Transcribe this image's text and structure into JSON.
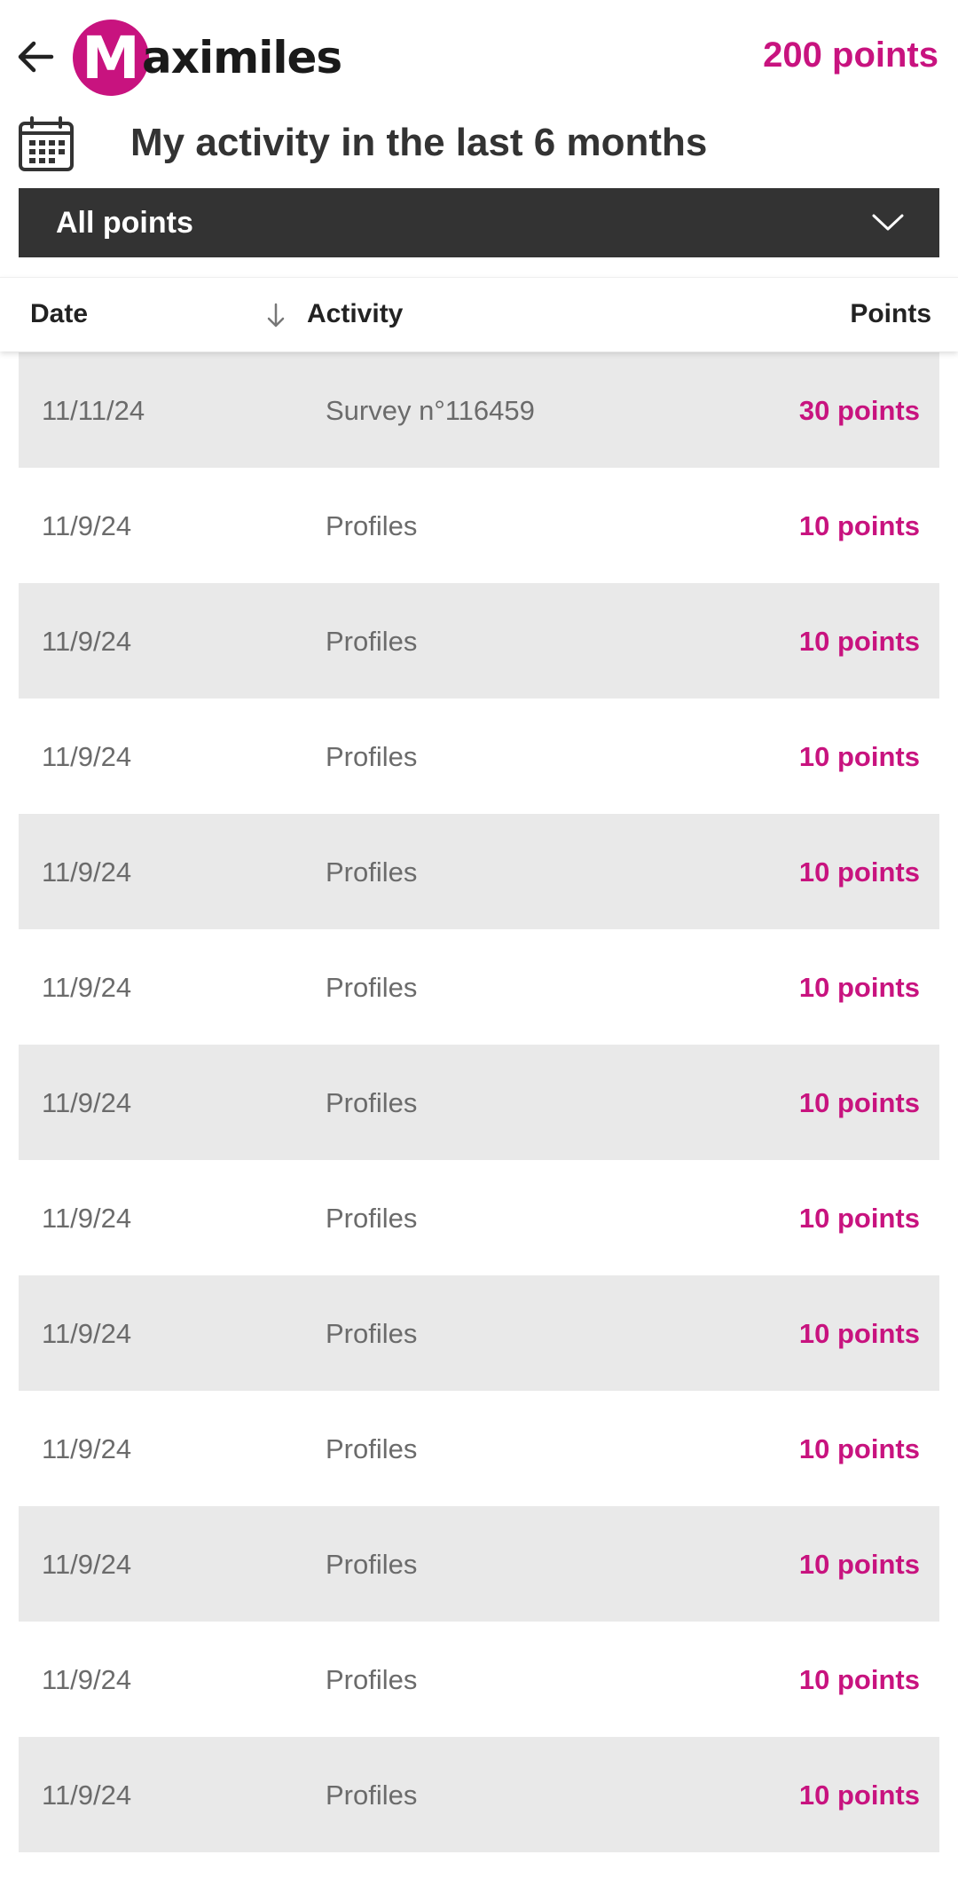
{
  "header": {
    "logo_letter": "M",
    "logo_rest": "aximiles",
    "total_points": "200 points"
  },
  "title": "My activity in the last 6 months",
  "filter": {
    "selected": "All points"
  },
  "table": {
    "columns": [
      "Date",
      "Activity",
      "Points"
    ],
    "rows": [
      {
        "date": "11/11/24",
        "activity": "Survey n°116459",
        "points": "30 points"
      },
      {
        "date": "11/9/24",
        "activity": "Profiles",
        "points": "10 points"
      },
      {
        "date": "11/9/24",
        "activity": "Profiles",
        "points": "10 points"
      },
      {
        "date": "11/9/24",
        "activity": "Profiles",
        "points": "10 points"
      },
      {
        "date": "11/9/24",
        "activity": "Profiles",
        "points": "10 points"
      },
      {
        "date": "11/9/24",
        "activity": "Profiles",
        "points": "10 points"
      },
      {
        "date": "11/9/24",
        "activity": "Profiles",
        "points": "10 points"
      },
      {
        "date": "11/9/24",
        "activity": "Profiles",
        "points": "10 points"
      },
      {
        "date": "11/9/24",
        "activity": "Profiles",
        "points": "10 points"
      },
      {
        "date": "11/9/24",
        "activity": "Profiles",
        "points": "10 points"
      },
      {
        "date": "11/9/24",
        "activity": "Profiles",
        "points": "10 points"
      },
      {
        "date": "11/9/24",
        "activity": "Profiles",
        "points": "10 points"
      },
      {
        "date": "11/9/24",
        "activity": "Profiles",
        "points": "10 points"
      }
    ]
  },
  "colors": {
    "accent": "#c8137f",
    "dark_bar": "#333333",
    "row_shade": "#e9e9e9"
  },
  "icons": {
    "back": "back-arrow-icon",
    "calendar": "calendar-icon",
    "dropdown": "chevron-down-icon",
    "sort": "sort-arrow-down-icon"
  }
}
